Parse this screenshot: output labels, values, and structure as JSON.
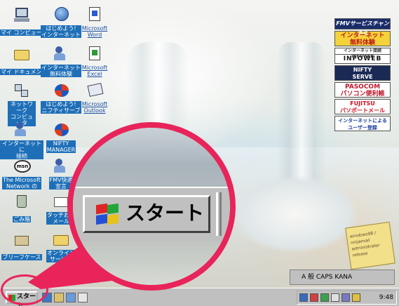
{
  "desktop": {
    "icons": [
      {
        "label": "マイ コンピュータ",
        "glyph": "computer-icon"
      },
      {
        "label": "はじめよう!\nインターネット",
        "glyph": "internet-icon"
      },
      {
        "label": "Microsoft\nWord",
        "glyph": "word-icon"
      },
      {
        "label": "マイ ドキュメント",
        "glyph": "folder-icon"
      },
      {
        "label": "インターネット\n無料体験",
        "glyph": "internet-trial-icon"
      },
      {
        "label": "Microsoft\nExcel",
        "glyph": "excel-icon"
      },
      {
        "label": "ネットワーク\nコンピュータ",
        "glyph": "network-icon"
      },
      {
        "label": "はじめよう!\nニフティサーブ",
        "glyph": "nifty-icon"
      },
      {
        "label": "Microsoft\nOutlook",
        "glyph": "outlook-icon"
      },
      {
        "label": "インターネットに\n接続",
        "glyph": "connect-icon"
      },
      {
        "label": "NIFTY\nMANAGER",
        "glyph": "nifty-manager-icon"
      },
      {
        "label": "The Microsoft\nNetwork の",
        "glyph": "msn-icon"
      },
      {
        "label": "FMV快適\n宣言",
        "glyph": "fmv-icon"
      },
      {
        "label": "ごみ箱",
        "glyph": "recycle-bin-icon"
      },
      {
        "label": "タッチおじ\nメール",
        "glyph": "mail-icon"
      },
      {
        "label": "ブリーフケース",
        "glyph": "briefcase-icon"
      },
      {
        "label": "オンライン\nサービス",
        "glyph": "online-services-icon"
      }
    ]
  },
  "banner": {
    "fmv": "FMVサービスチャンネル",
    "trial": "インターネット\n無料体験",
    "infoweb_caption": "インターネット接続INFOWEB",
    "infoweb": "INFOWEB",
    "nifty": "NIFTY\nSERVE",
    "pasocom": "PASOCOM\nパソコン便利帳",
    "fujitsu": "FUJITSU\nパソポートメール",
    "register": "インターネットによる\nユーザー登録"
  },
  "note": {
    "lines": [
      "windows98 / ninjamail",
      "administrator",
      "release"
    ]
  },
  "taskbar": {
    "start_label": "スタート",
    "ime_text": "A 般 CAPS KANA",
    "clock": "9:48"
  },
  "magnifier": {
    "start_label": "スタート"
  },
  "colors": {
    "accent_ring": "#e8245a",
    "taskbar": "#c0c0c0"
  }
}
